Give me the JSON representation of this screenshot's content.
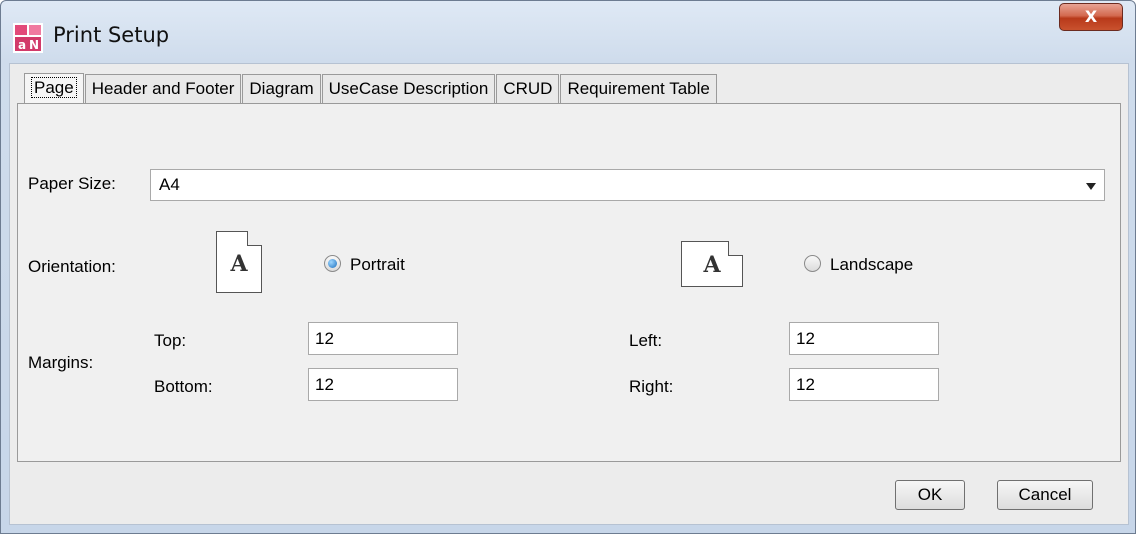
{
  "window": {
    "title": "Print Setup",
    "close_label": "X"
  },
  "tabs": [
    "Page",
    "Header and Footer",
    "Diagram",
    "UseCase Description",
    "CRUD",
    "Requirement Table"
  ],
  "page": {
    "paper_size_label": "Paper Size:",
    "paper_size_value": "A4",
    "orientation_label": "Orientation:",
    "icon_glyph": "A",
    "portrait_label": "Portrait",
    "landscape_label": "Landscape",
    "selected_orientation": "Portrait",
    "margins_label": "Margins:",
    "top_label": "Top:",
    "top_value": "12",
    "bottom_label": "Bottom:",
    "bottom_value": "12",
    "left_label": "Left:",
    "left_value": "12",
    "right_label": "Right:",
    "right_value": "12"
  },
  "buttons": {
    "ok": "OK",
    "cancel": "Cancel"
  },
  "colors": {
    "accent": "#1a6fbf",
    "close": "#c9522e"
  }
}
